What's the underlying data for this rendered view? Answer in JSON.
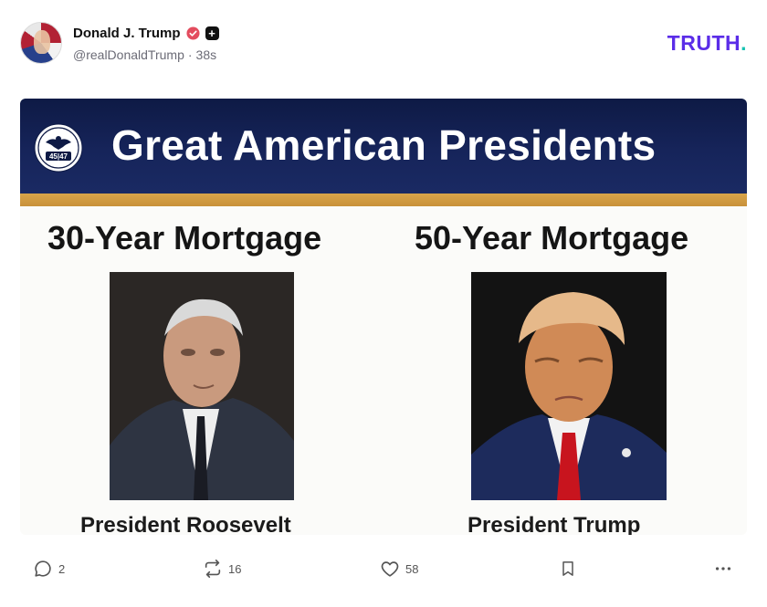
{
  "post": {
    "author": {
      "display_name": "Donald J. Trump",
      "handle": "@realDonaldTrump",
      "separator": "·",
      "timestamp": "38s"
    },
    "brand": {
      "logo_text": "TRUTH",
      "logo_dot": ".",
      "logo_color": "#5b2de8",
      "dot_color": "#17c3b2"
    },
    "media": {
      "banner_title": "Great American Presidents",
      "seal_text": "45|47",
      "left": {
        "heading": "30-Year Mortgage",
        "caption": "President Roosevelt"
      },
      "right": {
        "heading": "50-Year Mortgage",
        "caption": "President Trump"
      }
    },
    "actions": {
      "reply_count": "2",
      "retruth_count": "16",
      "like_count": "58",
      "icons": [
        "reply-icon",
        "retruth-icon",
        "heart-icon",
        "bookmark-icon",
        "more-icon"
      ]
    }
  }
}
